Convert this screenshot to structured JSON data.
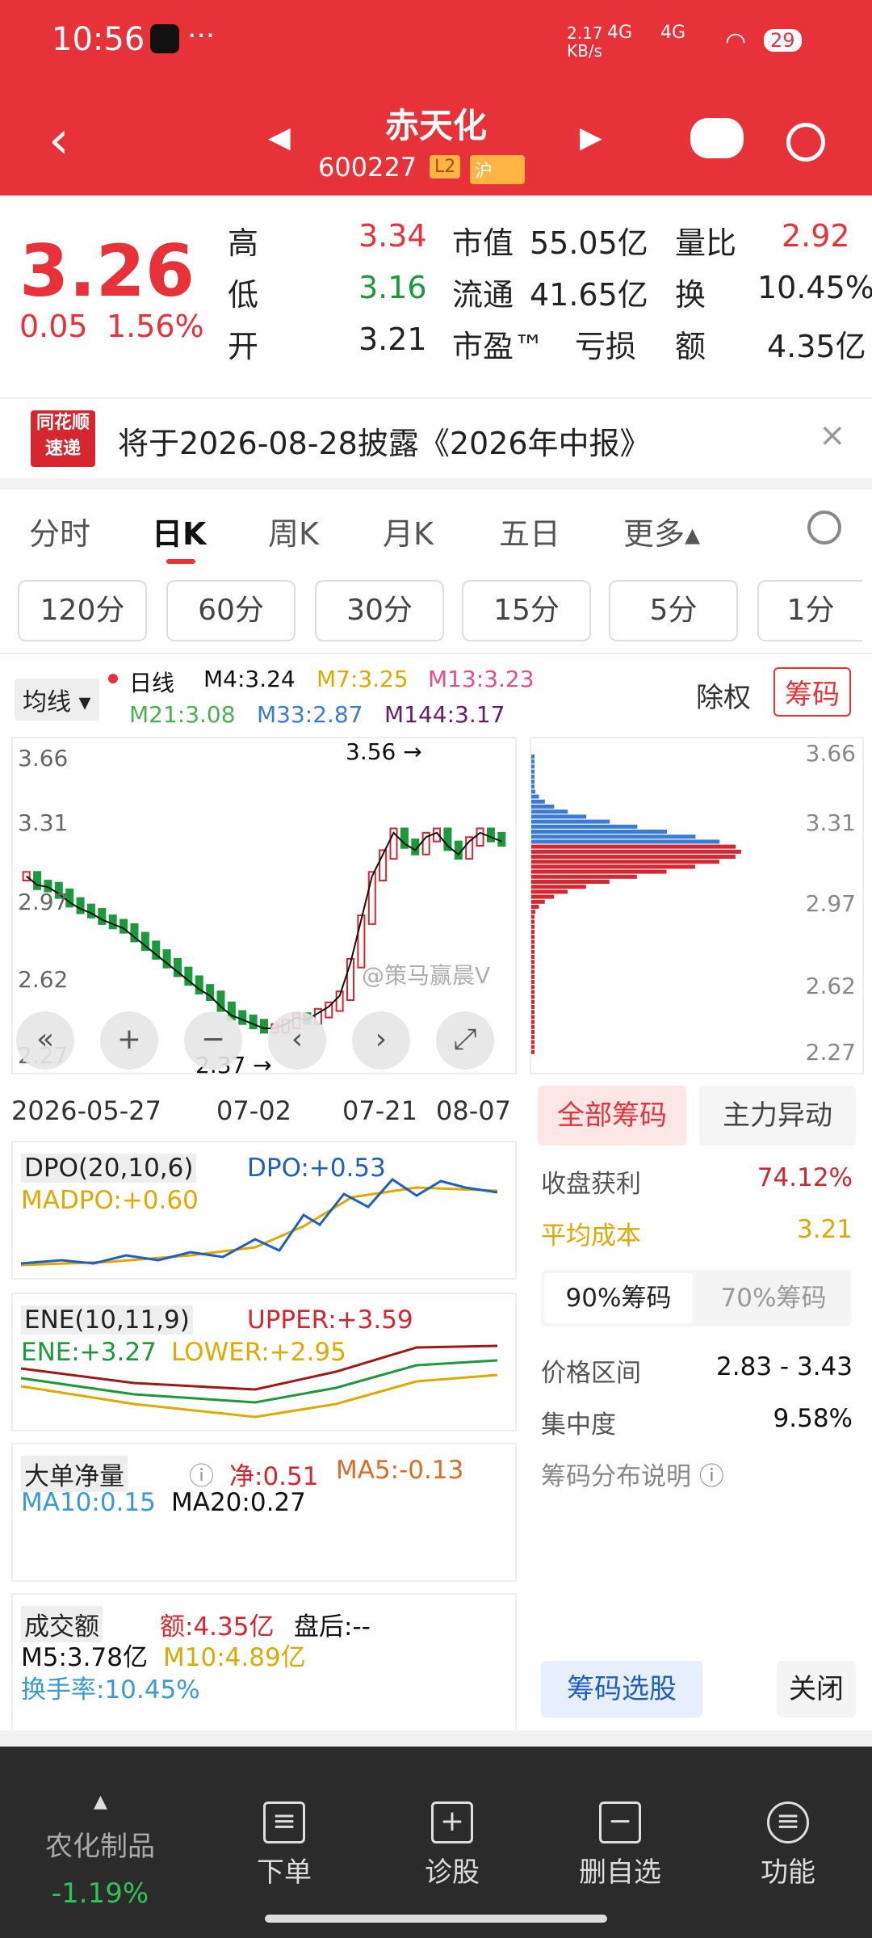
{
  "status": {
    "time": "10:56",
    "tiktok_icon": "tiktok-icon",
    "dots": "···",
    "net_speed_top": "2.17",
    "net_speed_bottom": "KB/s",
    "signal1": "4G",
    "signal2": "4G",
    "battery": "29"
  },
  "header": {
    "title": "赤天化",
    "code": "600227",
    "level_badge": "L2",
    "exchange_badge": "沪"
  },
  "quote": {
    "price": "3.26",
    "change": "0.05",
    "change_pct": "1.56%",
    "high_label": "高",
    "high": "3.34",
    "low_label": "低",
    "low": "3.16",
    "open_label": "开",
    "open": "3.21",
    "mcap_label": "市值",
    "mcap": "55.05亿",
    "float_label": "流通",
    "float": "41.65亿",
    "pe_label": "市盈™",
    "pe": "亏损",
    "volratio_label": "量比",
    "volratio": "2.92",
    "turnover_label": "换",
    "turnover": "10.45%",
    "amount_label": "额",
    "amount": "4.35亿"
  },
  "notice": {
    "logo_line1": "同花顺",
    "logo_line2": "速递",
    "text": "将于2026-08-28披露《2026年中报》",
    "close": "×"
  },
  "tabs": [
    {
      "label": "分时"
    },
    {
      "label": "日K"
    },
    {
      "label": "周K"
    },
    {
      "label": "月K"
    },
    {
      "label": "五日"
    },
    {
      "label": "更多▴"
    }
  ],
  "periods": [
    "120分",
    "60分",
    "30分",
    "15分",
    "5分",
    "1分"
  ],
  "ma": {
    "selector": "均线 ▾",
    "daily": "日线",
    "m4": "M4:3.24",
    "m7": "M7:3.25",
    "m13": "M13:3.23",
    "m21": "M21:3.08",
    "m33": "M33:2.87",
    "m144": "M144:3.17"
  },
  "chart_controls": {
    "exright": "除权",
    "chip": "筹码"
  },
  "chart_data": {
    "type": "candlestick",
    "y_ticks": [
      "3.66",
      "3.31",
      "2.97",
      "2.62",
      "2.27"
    ],
    "ylim": [
      2.27,
      3.66
    ],
    "x_ticks": [
      "2026-05-27",
      "07-02",
      "07-21",
      "08-07"
    ],
    "annotations": {
      "high": "3.56",
      "low": "2.37"
    },
    "chip_y_ticks": [
      "3.66",
      "3.31",
      "2.97",
      "2.62",
      "2.27"
    ],
    "close": [
      3.1,
      3.06,
      3.05,
      3.02,
      2.98,
      2.95,
      2.93,
      2.9,
      2.88,
      2.86,
      2.82,
      2.78,
      2.74,
      2.7,
      2.66,
      2.62,
      2.58,
      2.55,
      2.5,
      2.46,
      2.44,
      2.42,
      2.4,
      2.4,
      2.42,
      2.45,
      2.44,
      2.47,
      2.5,
      2.55,
      2.7,
      2.9,
      3.1,
      3.2,
      3.3,
      3.25,
      3.22,
      3.28,
      3.3,
      3.24,
      3.2,
      3.26,
      3.3,
      3.28,
      3.26
    ]
  },
  "watermark": "@策马赢晨V",
  "panels": {
    "dpo": {
      "name": "DPO(20,10,6)",
      "dpo": "DPO:+0.53",
      "madpo": "MADPO:+0.60"
    },
    "ene": {
      "name": "ENE(10,11,9)",
      "upper": "UPPER:+3.59",
      "ene": "ENE:+3.27",
      "lower": "LOWER:+2.95"
    },
    "bigorder": {
      "name": "大单净量",
      "net": "净:0.51",
      "ma5": "MA5:-0.13",
      "ma10": "MA10:0.15",
      "ma20": "MA20:0.27"
    },
    "volume": {
      "name": "成交额",
      "amount": "额:4.35亿",
      "after": "盘后:--",
      "m5": "M5:3.78亿",
      "m10": "M10:4.89亿",
      "turnover": "换手率:10.45%"
    }
  },
  "chips": {
    "all": "全部筹码",
    "main": "主力异动",
    "profit_label": "收盘获利",
    "profit": "74.12%",
    "avgcost_label": "平均成本",
    "avgcost": "3.21",
    "seg90": "90%筹码",
    "seg70": "70%筹码",
    "range_label": "价格区间",
    "range": "2.83 - 3.43",
    "conc_label": "集中度",
    "conc": "9.58%",
    "explain": "筹码分布说明 ⓘ",
    "choose": "筹码选股",
    "close": "关闭"
  },
  "bottom": {
    "sector": "农化制品",
    "sector_change": "-1.19%",
    "order": "下单",
    "diagnose": "诊股",
    "remove": "删自选",
    "func": "功能"
  }
}
